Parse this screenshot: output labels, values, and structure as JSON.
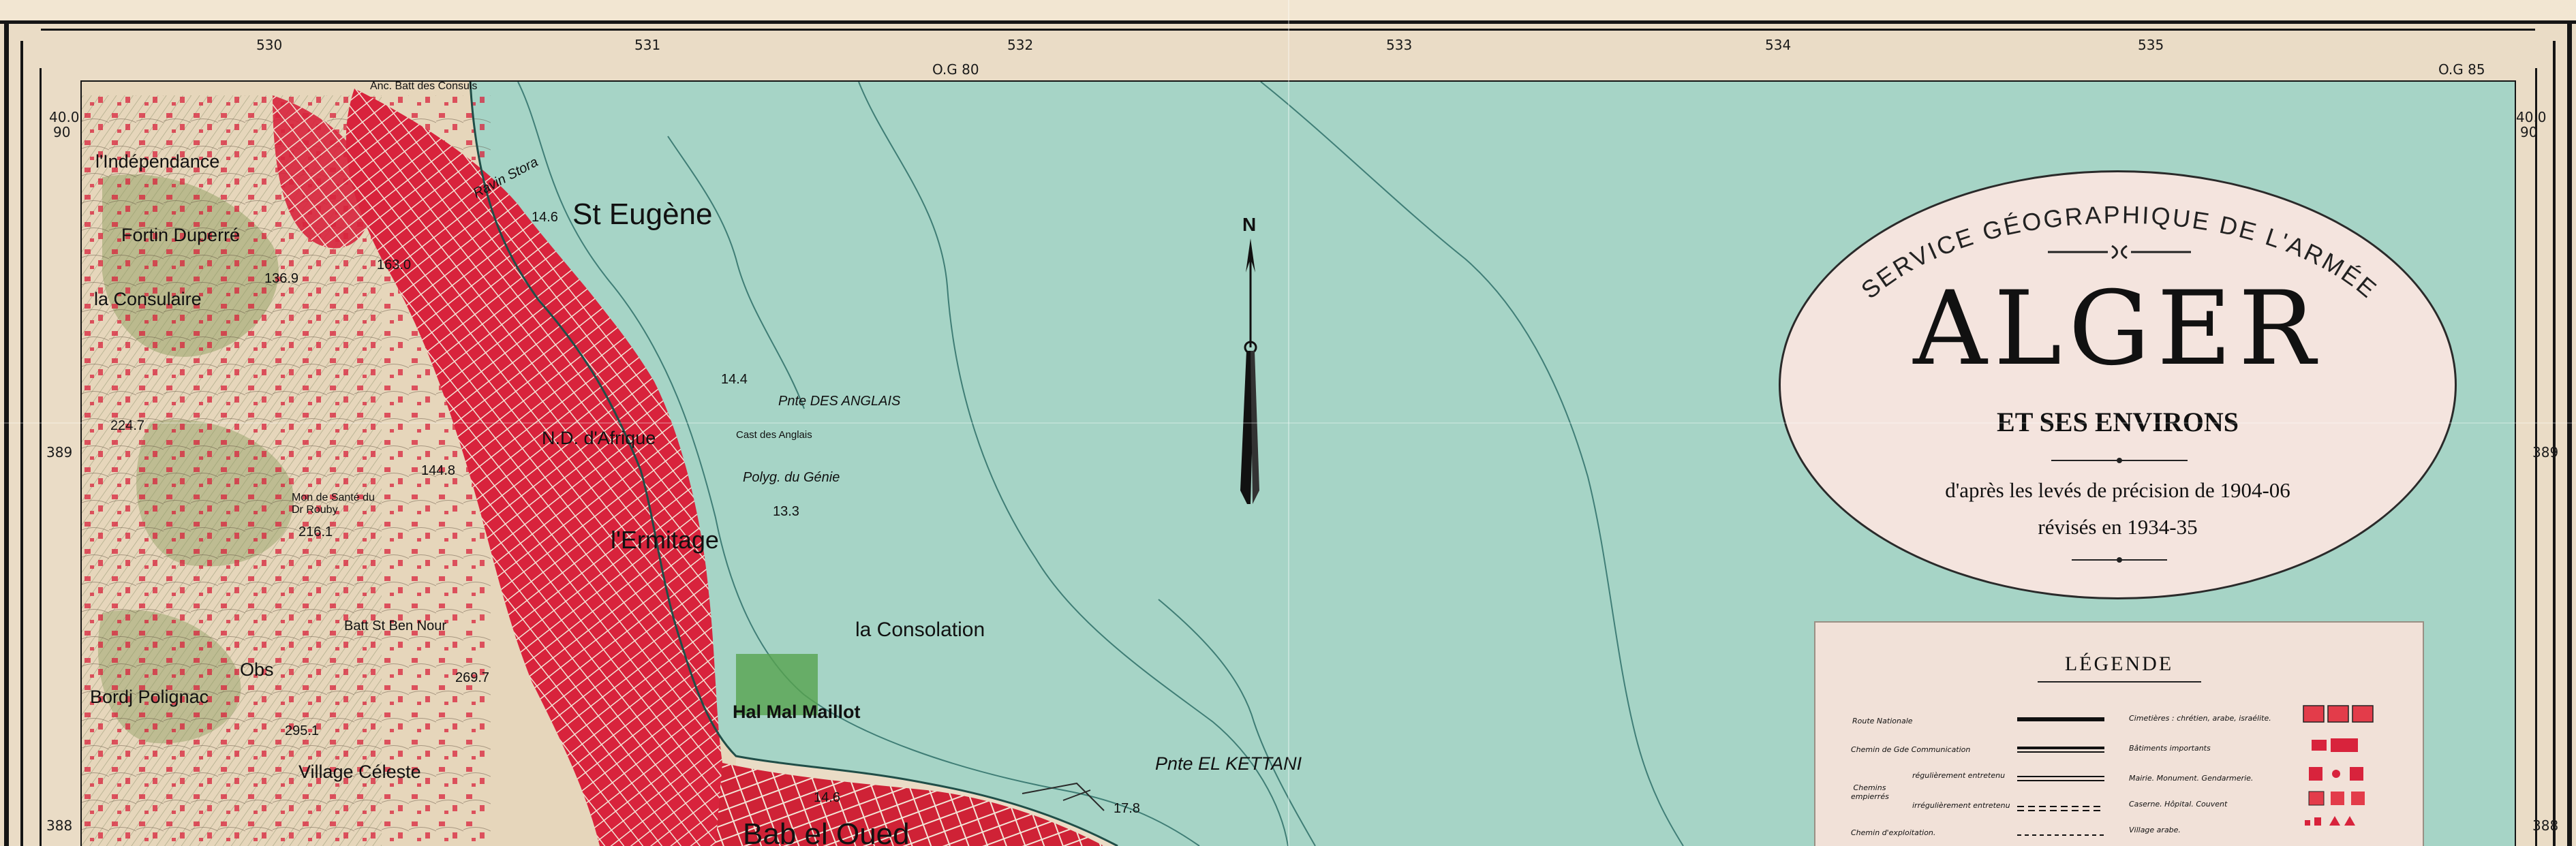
{
  "grid": {
    "top_ticks": [
      "530",
      "531",
      "532",
      "533",
      "534",
      "535"
    ],
    "og_labels": [
      "O.G 80",
      "O.G 85"
    ],
    "left_labels": [
      "40.0",
      "90",
      "389",
      "388"
    ],
    "right_labels": [
      "40.0",
      "90",
      "389",
      "388"
    ]
  },
  "places": {
    "independance": "l'Indépendance",
    "fortin": "Fortin Duperré",
    "consulaire": "la Consulaire",
    "st_eugene": "St Eugène",
    "nd_afrique": "N.D. d'Afrique",
    "ermitage": "l'Ermitage",
    "consolation": "la Consolation",
    "maillot": "Hal Mal Maillot",
    "bordj": "Bordj Polignac",
    "village_celeste": "Village Céleste",
    "obs": "Obs",
    "pointe_anglais": "Pnte DES ANGLAIS",
    "cast_anglais": "Cast des Anglais",
    "polyg_genie": "Polyg. du Génie",
    "ravin_stora": "Ravin Stora",
    "pointe_kettani": "Pnte EL KETTANI",
    "anc_bat_consuls": "Anc. Batt des Consuls",
    "bat_ben_nour": "Batt St Ben Nour",
    "maison_sante": "Mon de Santé du Dr Rouby",
    "bab_el_oued": "Bab el Oued"
  },
  "spot_heights": [
    "136.9",
    "163.0",
    "224.7",
    "144.8",
    "216.1",
    "269.7",
    "295.1",
    "14.6",
    "14.4",
    "13.3",
    "14.6",
    "17.8"
  ],
  "north_arrow": {
    "label": "N"
  },
  "cartouche": {
    "agency": "SERVICE GÉOGRAPHIQUE DE L'ARMÉE",
    "title": "ALGER",
    "subtitle": "ET SES ENVIRONS",
    "survey_line1": "d'après les levés de précision de 1904-06",
    "survey_line2": "révisés en 1934-35"
  },
  "legend": {
    "title": "LÉGENDE",
    "left_items": [
      "Route Nationale",
      "Chemin de Gde Communication",
      "Chemins empierrés",
      "régulièrement entretenu",
      "irrégulièrement entretenu",
      "Chemin d'exploitation."
    ],
    "right_items": [
      "Cimetières : chrétien, arabe, israélite.",
      "Bâtiments importants",
      "Mairie. Monument. Gendarmerie.",
      "Caserne. Hôpital. Couvent",
      "Village arabe."
    ]
  },
  "colors": {
    "sea": "#a5d3c6",
    "land": "#ecdcc8",
    "urban": "#d9243a",
    "relief": "#8d9a6a",
    "contour": "#2e6f68"
  }
}
